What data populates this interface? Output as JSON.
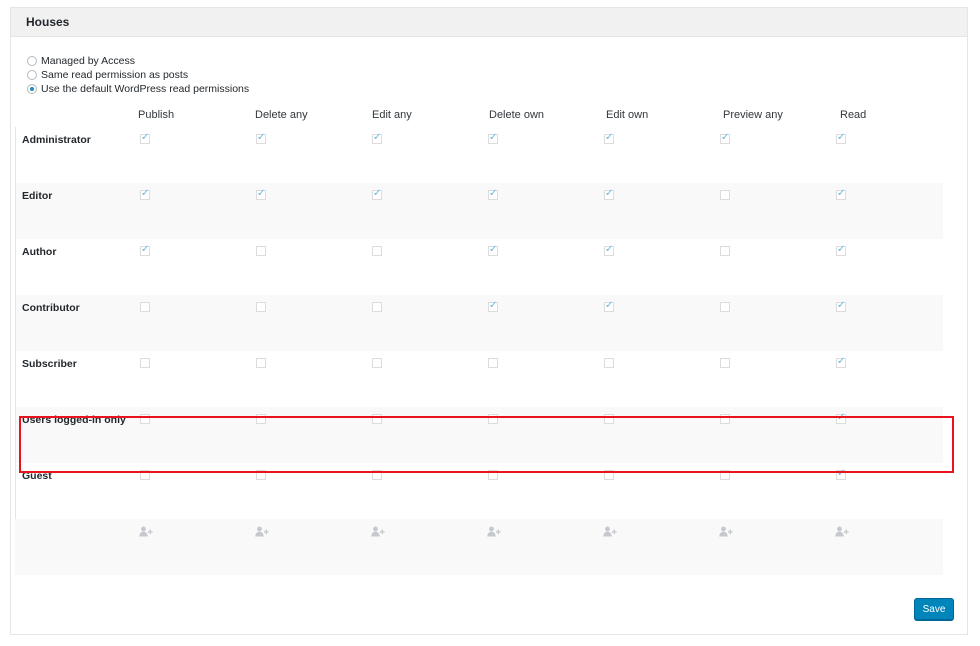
{
  "panel": {
    "title": "Houses"
  },
  "access_options": [
    {
      "label": "Managed by Access",
      "selected": false
    },
    {
      "label": "Same read permission as posts",
      "selected": false
    },
    {
      "label": "Use the default WordPress read permissions",
      "selected": true
    }
  ],
  "permissions_table": {
    "columns": [
      "Publish",
      "Delete any",
      "Edit any",
      "Delete own",
      "Edit own",
      "Preview any",
      "Read"
    ],
    "rows": [
      {
        "role": "Administrator",
        "values": [
          true,
          true,
          true,
          true,
          true,
          true,
          true
        ]
      },
      {
        "role": "Editor",
        "values": [
          true,
          true,
          true,
          true,
          true,
          false,
          true
        ]
      },
      {
        "role": "Author",
        "values": [
          true,
          false,
          false,
          true,
          true,
          false,
          true
        ]
      },
      {
        "role": "Contributor",
        "values": [
          false,
          false,
          false,
          true,
          true,
          false,
          true
        ]
      },
      {
        "role": "Subscriber",
        "values": [
          false,
          false,
          false,
          false,
          false,
          false,
          true
        ]
      },
      {
        "role": "Users logged-in only",
        "values": [
          false,
          false,
          false,
          false,
          false,
          false,
          true
        ],
        "highlighted": true
      },
      {
        "role": "Guest",
        "values": [
          false,
          false,
          false,
          false,
          false,
          false,
          true
        ]
      }
    ]
  },
  "add_user_icon": "add-user-icon",
  "accent_colors": {
    "highlight_border": "#e8131d",
    "save_button": "#0085ba",
    "check": "#5bb7e5"
  },
  "buttons": {
    "save_label": "Save"
  }
}
